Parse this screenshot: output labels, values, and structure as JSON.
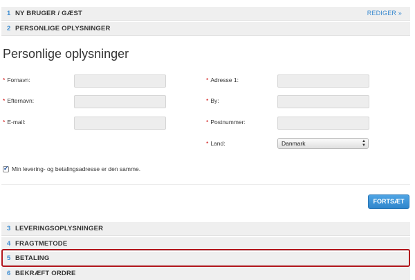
{
  "steps": [
    {
      "num": "1",
      "label": "NY BRUGER / GÆST",
      "edit": "REDIGER »"
    },
    {
      "num": "2",
      "label": "PERSONLIGE OPLYSNINGER"
    },
    {
      "num": "3",
      "label": "LEVERINGSOPLYSNINGER"
    },
    {
      "num": "4",
      "label": "FRAGTMETODE"
    },
    {
      "num": "5",
      "label": "BETALING"
    },
    {
      "num": "6",
      "label": "BEKRÆFT ORDRE"
    }
  ],
  "form": {
    "title": "Personlige oplysninger",
    "required_mark": "*",
    "first_name_label": "Fornavn:",
    "last_name_label": "Efternavn:",
    "email_label": "E-mail:",
    "address1_label": "Adresse 1:",
    "city_label": "By:",
    "postcode_label": "Postnummer:",
    "country_label": "Land:",
    "country_value": "Danmark",
    "first_name_value": "",
    "last_name_value": "",
    "email_value": "",
    "address1_value": "",
    "city_value": "",
    "postcode_value": "",
    "same_address_label": "Min levering- og betalingsadresse er den samme.",
    "same_address_checked": true,
    "continue_label": "FORTSÆT"
  },
  "colors": {
    "accent": "#3b8bd0",
    "required": "#cc0000",
    "highlight": "#b3161d"
  }
}
